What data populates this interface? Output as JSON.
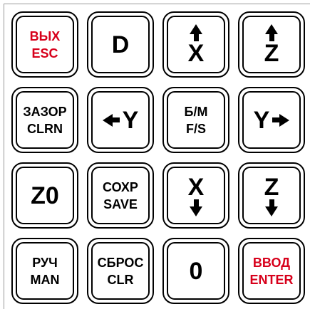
{
  "keypad": {
    "keys": [
      {
        "id": "esc",
        "line1": "ВЫХ",
        "line2": "ESC",
        "color": "#d7001b"
      },
      {
        "id": "d",
        "label": "D"
      },
      {
        "id": "x_up",
        "label": "X",
        "icon": "arrow-up-icon"
      },
      {
        "id": "z_up",
        "label": "Z",
        "icon": "arrow-up-icon"
      },
      {
        "id": "clrn",
        "line1": "ЗАЗОР",
        "line2": "CLRN"
      },
      {
        "id": "y_left",
        "label": "Y",
        "icon": "arrow-left-icon"
      },
      {
        "id": "fs",
        "line1": "Б/М",
        "line2": "F/S"
      },
      {
        "id": "y_right",
        "label": "Y",
        "icon": "arrow-right-icon"
      },
      {
        "id": "z0",
        "label": "Z0"
      },
      {
        "id": "save",
        "line1": "СОХР",
        "line2": "SAVE"
      },
      {
        "id": "x_down",
        "label": "X",
        "icon": "arrow-down-icon"
      },
      {
        "id": "z_down",
        "label": "Z",
        "icon": "arrow-down-icon"
      },
      {
        "id": "man",
        "line1": "РУЧ",
        "line2": "MAN"
      },
      {
        "id": "clr",
        "line1": "СБРОС",
        "line2": "CLR"
      },
      {
        "id": "zero",
        "label": "0"
      },
      {
        "id": "enter",
        "line1": "ВВОД",
        "line2": "ENTER",
        "color": "#d7001b"
      }
    ]
  }
}
